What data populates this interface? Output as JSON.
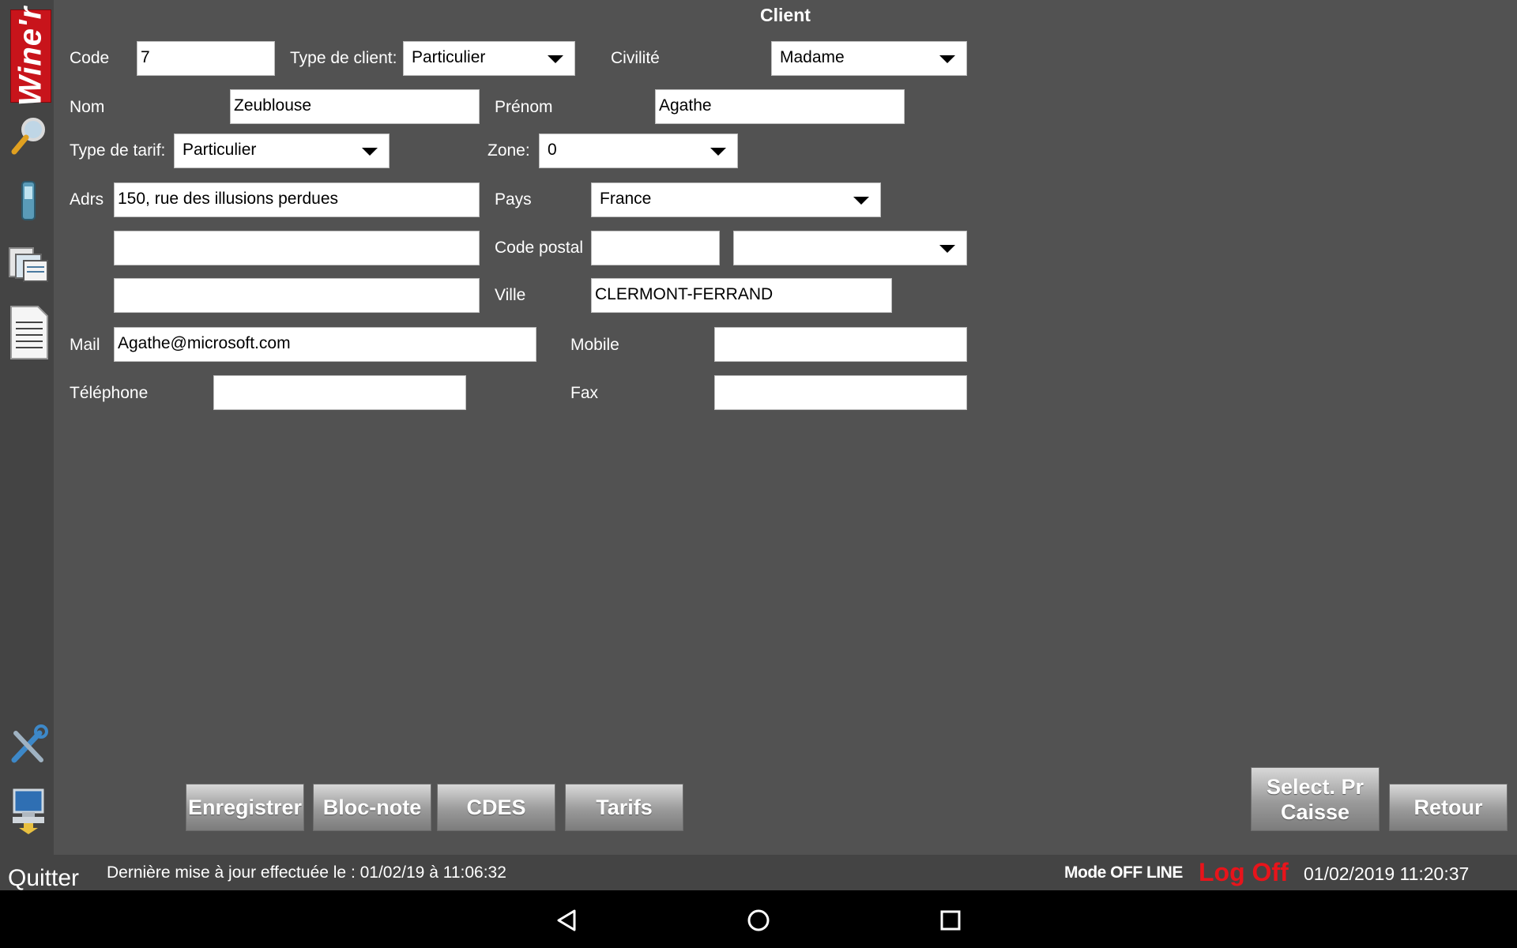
{
  "app": {
    "logo_text": "Wine'r",
    "page_title": "Client"
  },
  "sidebar": {
    "icons": [
      "magnifier-icon",
      "mobile-phone-icon",
      "documents-icon",
      "document-page-icon",
      "tools-icon",
      "computer-download-icon"
    ]
  },
  "form": {
    "code": {
      "label": "Code",
      "value": "7"
    },
    "type_client": {
      "label": "Type de client:",
      "value": "Particulier"
    },
    "civilite": {
      "label": "Civilité",
      "value": "Madame"
    },
    "nom": {
      "label": "Nom",
      "value": "Zeublouse"
    },
    "prenom": {
      "label": "Prénom",
      "value": "Agathe"
    },
    "type_tarif": {
      "label": "Type de tarif:",
      "value": "Particulier"
    },
    "zone": {
      "label": "Zone:",
      "value": "0"
    },
    "adrs": {
      "label": "Adrs",
      "line1": "150, rue des illusions perdues",
      "line2": "",
      "line3": ""
    },
    "pays": {
      "label": "Pays",
      "value": "France"
    },
    "code_postal": {
      "label": "Code postal",
      "value": "",
      "select_value": ""
    },
    "ville": {
      "label": "Ville",
      "value": "CLERMONT-FERRAND"
    },
    "mail": {
      "label": "Mail",
      "value": "Agathe@microsoft.com"
    },
    "mobile": {
      "label": "Mobile",
      "value": ""
    },
    "telephone": {
      "label": "Téléphone",
      "value": ""
    },
    "fax": {
      "label": "Fax",
      "value": ""
    }
  },
  "buttons": {
    "enregistrer": "Enregistrer",
    "bloc_note": "Bloc-note",
    "cdes": "CDES",
    "tarifs": "Tarifs",
    "select_caisse_line1": "Select. Pr",
    "select_caisse_line2": "Caisse",
    "retour": "Retour"
  },
  "status": {
    "quitter": "Quitter",
    "last_update": "Dernière mise à jour effectuée le : 01/02/19 à 11:06:32",
    "mode": "Mode OFF LINE",
    "log_off": "Log Off",
    "datetime": "01/02/2019 11:20:37"
  },
  "colors": {
    "background": "#525252",
    "sidebar": "#444444",
    "logo_red": "#c8141b",
    "log_off_red": "#e8141b"
  }
}
